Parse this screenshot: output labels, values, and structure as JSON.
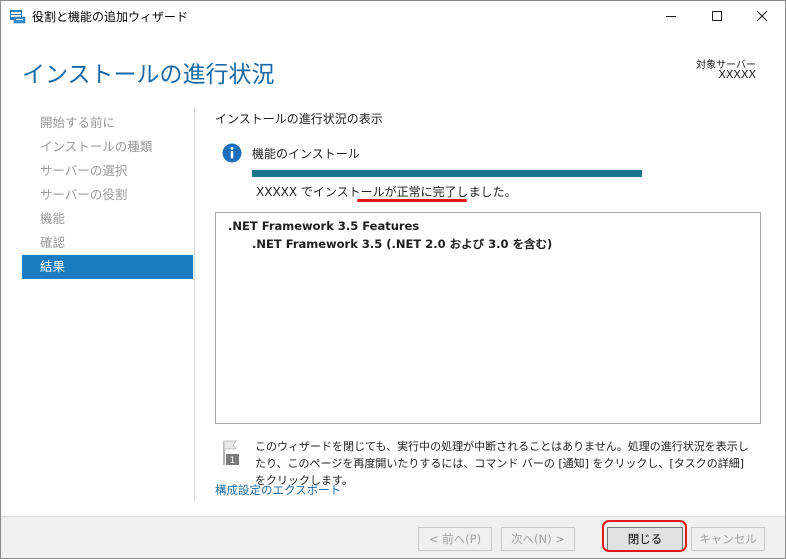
{
  "window": {
    "title": "役割と機能の追加ウィザード",
    "minimize_icon": "minimize-icon",
    "maximize_icon": "maximize-icon",
    "close_icon": "close-icon"
  },
  "header": {
    "page_title": "インストールの進行状況",
    "server_label": "対象サーバー",
    "server_name": "XXXXX"
  },
  "sidebar": {
    "items": [
      {
        "label": "開始する前に",
        "active": false
      },
      {
        "label": "インストールの種類",
        "active": false
      },
      {
        "label": "サーバーの選択",
        "active": false
      },
      {
        "label": "サーバーの役割",
        "active": false
      },
      {
        "label": "機能",
        "active": false
      },
      {
        "label": "確認",
        "active": false
      },
      {
        "label": "結果",
        "active": true
      }
    ]
  },
  "main": {
    "section_title": "インストールの進行状況の表示",
    "status_icon": "info-icon",
    "feature_status": "機能のインストール",
    "progress_fraction": 1.0,
    "result_message": "XXXXX でインストールが正常に完了しました。",
    "results": [
      ".NET Framework 3.5 Features",
      ".NET Framework 3.5 (.NET 2.0 および 3.0 を含む)"
    ],
    "notice_icon": "flag-icon",
    "notice_badge": "1",
    "notice_text": "このウィザードを閉じても、実行中の処理が中断されることはありません。処理の進行状況を表示したり、このページを再度開いたりするには、コマンド バーの [通知] をクリックし、[タスクの詳細] をクリックします。",
    "export_link": "構成設定のエクスポート"
  },
  "footer": {
    "prev_label": "< 前へ(P)",
    "next_label": "次へ(N) >",
    "close_label": "閉じる",
    "cancel_label": "キャンセル"
  },
  "colors": {
    "accent": "#1c7bc1",
    "title_blue": "#1b6aa5",
    "progress": "#19758e",
    "annotation_red": "#e0191c"
  }
}
